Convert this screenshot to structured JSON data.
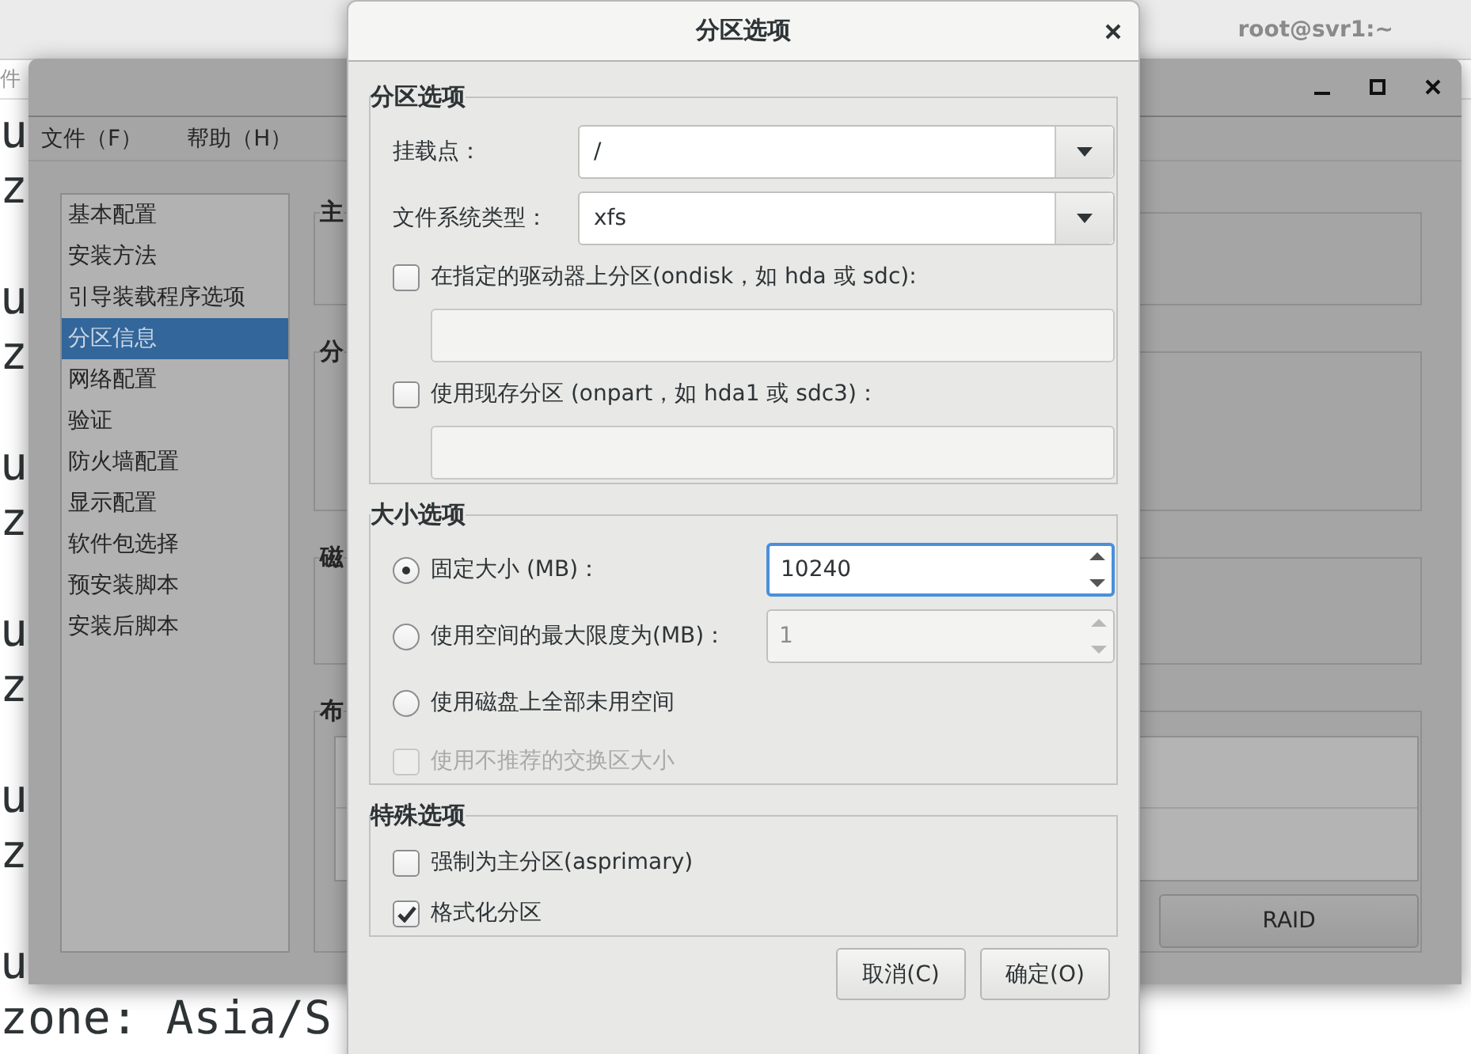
{
  "terminal": {
    "menu_fragment": "件",
    "title": "root@svr1:~",
    "blocks": [
      [
        "u",
        "z"
      ],
      [
        "u",
        "z"
      ],
      [
        "u",
        "z"
      ],
      [
        "u",
        "z"
      ],
      [
        "u",
        "z"
      ],
      [
        "u",
        "zone: Asia/S"
      ]
    ]
  },
  "main_window": {
    "menu": [
      "文件（F）",
      "帮助（H）"
    ],
    "sidebar": {
      "items": [
        {
          "label": "基本配置",
          "selected": false
        },
        {
          "label": "安装方法",
          "selected": false
        },
        {
          "label": "引导装载程序选项",
          "selected": false
        },
        {
          "label": "分区信息",
          "selected": true
        },
        {
          "label": "网络配置",
          "selected": false
        },
        {
          "label": "验证",
          "selected": false
        },
        {
          "label": "防火墙配置",
          "selected": false
        },
        {
          "label": "显示配置",
          "selected": false
        },
        {
          "label": "软件包选择",
          "selected": false
        },
        {
          "label": "预安装脚本",
          "selected": false
        },
        {
          "label": "安装后脚本",
          "selected": false
        }
      ]
    },
    "groups": [
      {
        "kind": "plain",
        "label": "主"
      },
      {
        "kind": "plain",
        "label": "分"
      },
      {
        "kind": "plain",
        "label": "磁"
      },
      {
        "kind": "list",
        "label": "布",
        "button": "RAID"
      }
    ]
  },
  "dialog": {
    "title": "分区选项",
    "sections": [
      {
        "title": "分区选项",
        "rows": [
          {
            "kind": "combo",
            "label": "挂载点：",
            "value": "/"
          },
          {
            "kind": "combo",
            "label": "文件系统类型：",
            "value": "xfs"
          },
          {
            "kind": "checkbox",
            "label": "在指定的驱动器上分区(ondisk，如 hda 或 sdc):",
            "checked": false,
            "disabled": false
          },
          {
            "kind": "entry",
            "disabled": true
          },
          {
            "kind": "checkbox",
            "label": "使用现存分区 (onpart，如 hda1 或 sdc3)：",
            "checked": false,
            "disabled": false
          },
          {
            "kind": "entry",
            "disabled": true
          }
        ]
      },
      {
        "title": "大小选项",
        "rows": [
          {
            "kind": "radio",
            "label": "固定大小 (MB)：",
            "selected": true,
            "spin": {
              "value": "10240",
              "focused": true,
              "disabled": false
            }
          },
          {
            "kind": "radio",
            "label": "使用空间的最大限度为(MB)：",
            "selected": false,
            "spin": {
              "value": "1",
              "focused": false,
              "disabled": true
            }
          },
          {
            "kind": "radio",
            "label": "使用磁盘上全部未用空间",
            "selected": false
          },
          {
            "kind": "checkbox",
            "label": "使用不推荐的交换区大小",
            "checked": false,
            "disabled": true
          }
        ]
      },
      {
        "title": "特殊选项",
        "rows": [
          {
            "kind": "checkbox",
            "label": "强制为主分区(asprimary)",
            "checked": false,
            "disabled": false
          },
          {
            "kind": "checkbox",
            "label": "格式化分区",
            "checked": true,
            "disabled": false
          }
        ]
      }
    ],
    "buttons": [
      "取消(C)",
      "确定(O)"
    ]
  }
}
